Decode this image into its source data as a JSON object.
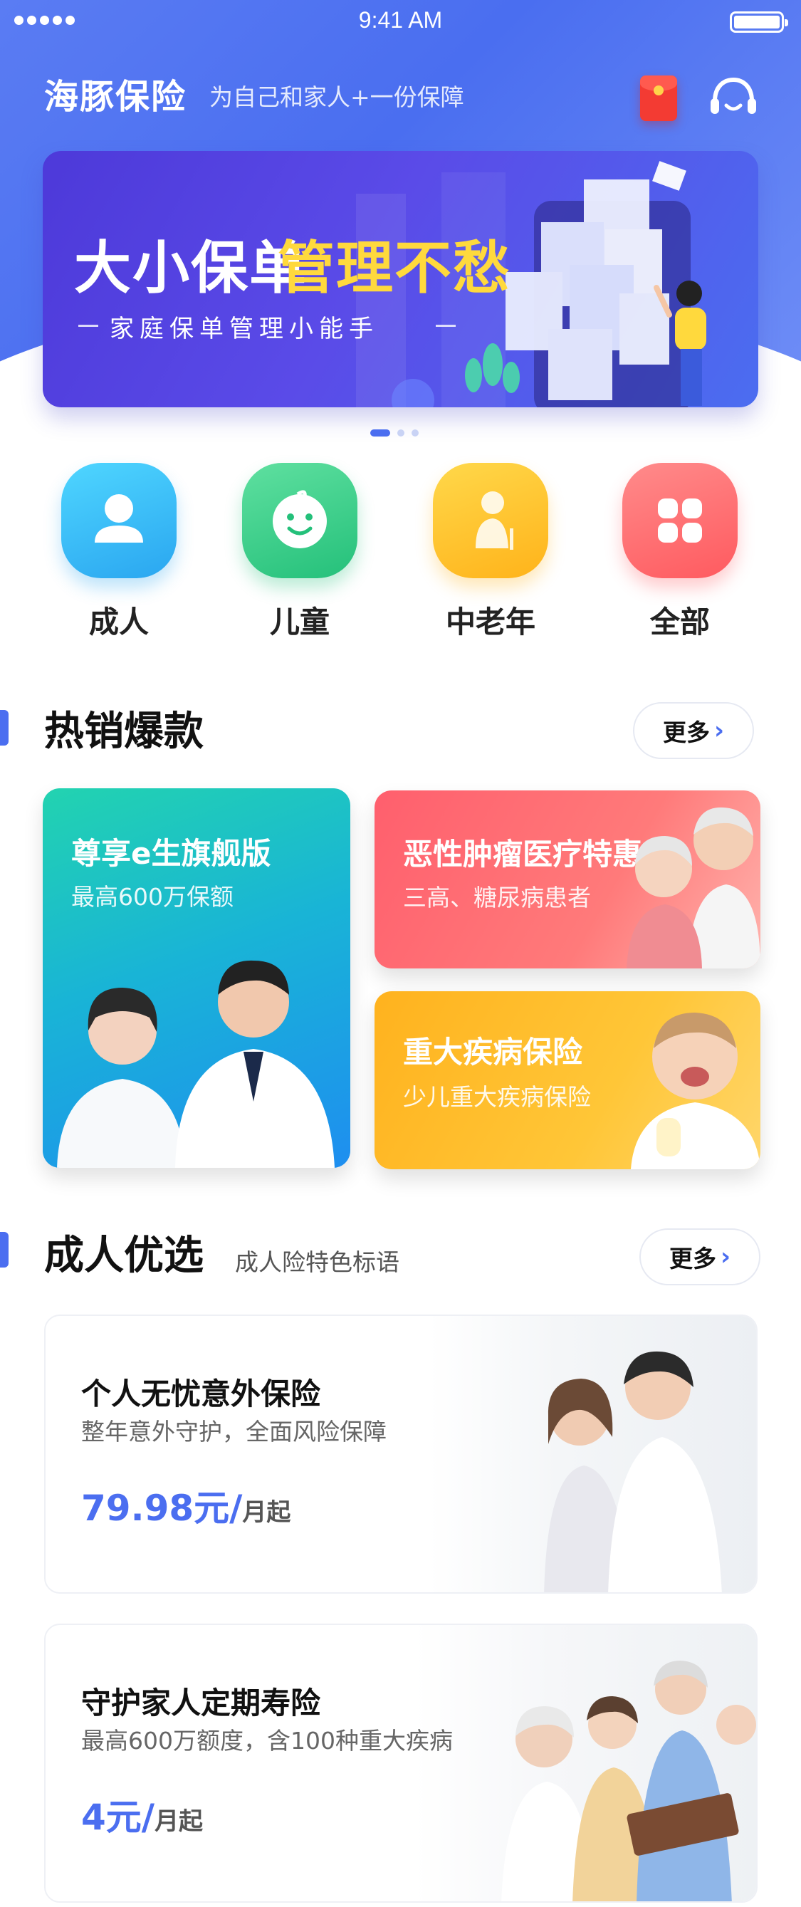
{
  "status_bar": {
    "time": "9:41 AM"
  },
  "header": {
    "brand": "海豚保险",
    "slogan": "为自己和家人+一份保障"
  },
  "banner": {
    "title_part1": "大小保单",
    "title_part2": "管理不愁",
    "subtitle": "家庭保单管理小能手",
    "page_count": 3,
    "active_page": 1
  },
  "categories": [
    {
      "label": "成人",
      "icon": "user-icon",
      "color": "#35c4f2"
    },
    {
      "label": "儿童",
      "icon": "baby-face-icon",
      "color": "#39d08a"
    },
    {
      "label": "中老年",
      "icon": "elder-icon",
      "color": "#ffc12b"
    },
    {
      "label": "全部",
      "icon": "grid-icon",
      "color": "#ff6b6b"
    }
  ],
  "hot_section": {
    "title": "热销爆款",
    "more": "更多",
    "cards": [
      {
        "title": "尊享e生旗舰版",
        "subtitle": "最高600万保额"
      },
      {
        "title": "恶性肿瘤医疗特惠",
        "subtitle": "三高、糖尿病患者"
      },
      {
        "title": "重大疾病保险",
        "subtitle": "少儿重大疾病保险"
      }
    ]
  },
  "adult_section": {
    "title": "成人优选",
    "subtitle": "成人险特色标语",
    "more": "更多",
    "products": [
      {
        "title": "个人无忧意外保险",
        "desc": "整年意外守护，全面风险保障",
        "price": "79.98元/",
        "unit": "月起"
      },
      {
        "title": "守护家人定期寿险",
        "desc": "最高600万额度，含100种重大疾病",
        "price": "4元/",
        "unit": "月起"
      }
    ]
  },
  "colors": {
    "accent": "#4b6ef0",
    "header_gradient": "#5a7cf3"
  }
}
